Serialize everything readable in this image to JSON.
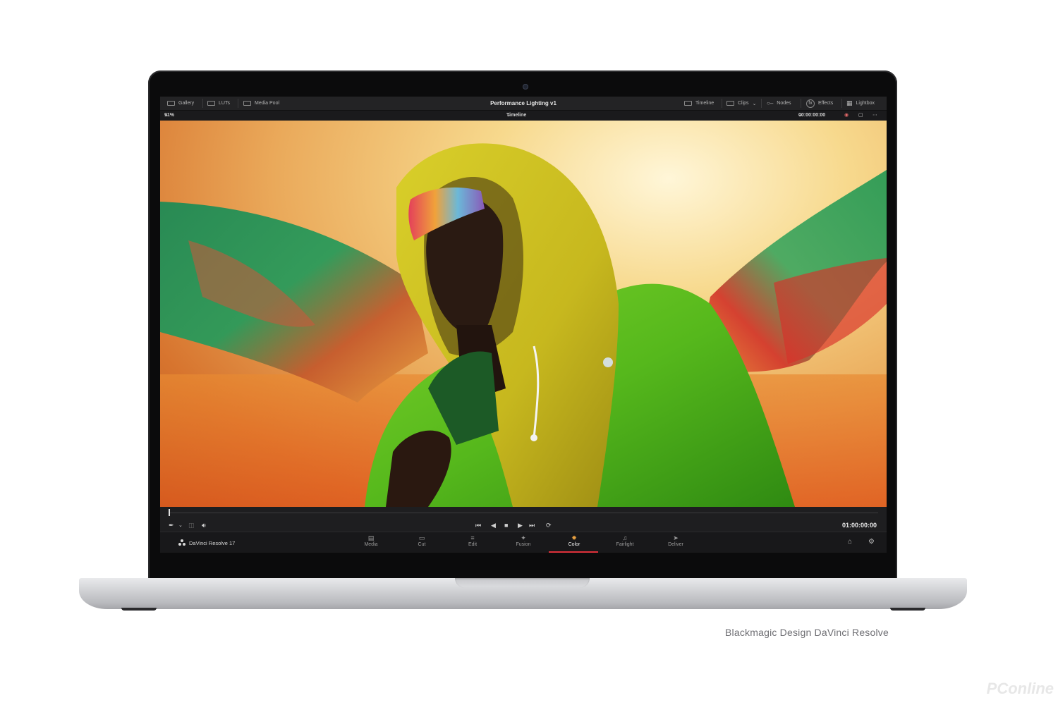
{
  "app": {
    "title": "Performance Lighting v1",
    "timeline": "Timeline 1",
    "zoom": "91%",
    "timecode_top": "00:00:00:00",
    "timecode_main": "01:00:00:00",
    "brand": "DaVinci Resolve 17"
  },
  "topbar": {
    "left": [
      {
        "label": "Gallery",
        "icon": "gallery-icon"
      },
      {
        "label": "LUTs",
        "icon": "luts-icon"
      },
      {
        "label": "Media Pool",
        "icon": "media-pool-icon"
      }
    ],
    "right": [
      {
        "label": "Timeline",
        "icon": "timeline-icon"
      },
      {
        "label": "Clips",
        "icon": "clips-icon"
      },
      {
        "label": "Nodes",
        "icon": "nodes-icon"
      },
      {
        "label": "Effects",
        "icon": "effects-icon"
      },
      {
        "label": "Lightbox",
        "icon": "lightbox-icon"
      }
    ]
  },
  "pages": [
    {
      "label": "Media",
      "icon": "media-page-icon"
    },
    {
      "label": "Cut",
      "icon": "cut-page-icon"
    },
    {
      "label": "Edit",
      "icon": "edit-page-icon"
    },
    {
      "label": "Fusion",
      "icon": "fusion-page-icon"
    },
    {
      "label": "Color",
      "icon": "color-page-icon",
      "active": true
    },
    {
      "label": "Fairlight",
      "icon": "fairlight-page-icon"
    },
    {
      "label": "Deliver",
      "icon": "deliver-page-icon"
    }
  ],
  "caption": "Blackmagic Design DaVinci Resolve",
  "watermark": "PConline",
  "colors": {
    "accent_active": "#e0313b",
    "ui_bg": "#1c1c1e",
    "laptop_silver": "#d4d5d8"
  }
}
